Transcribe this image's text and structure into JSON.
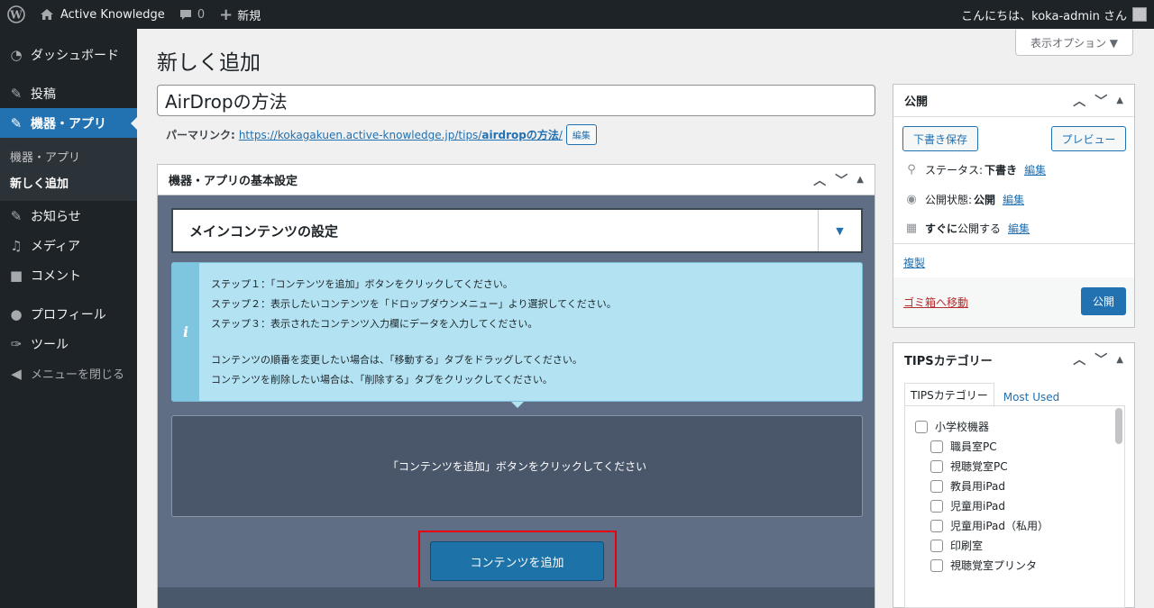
{
  "adminbar": {
    "site_name": "Active Knowledge",
    "comments_count": "0",
    "new_label": "新規",
    "greeting": "こんにちは、koka-admin さん"
  },
  "sidebar": {
    "items": [
      {
        "label": "ダッシュボード",
        "icon": "dashboard-icon"
      },
      {
        "label": "投稿",
        "icon": "pin-icon"
      },
      {
        "label": "機器・アプリ",
        "icon": "pin-icon"
      },
      {
        "label": "お知らせ",
        "icon": "pin-icon"
      },
      {
        "label": "メディア",
        "icon": "media-icon"
      },
      {
        "label": "コメント",
        "icon": "comment-icon"
      },
      {
        "label": "プロフィール",
        "icon": "user-icon"
      },
      {
        "label": "ツール",
        "icon": "wrench-icon"
      }
    ],
    "submenu": [
      "機器・アプリ",
      "新しく追加"
    ],
    "collapse_label": "メニューを閉じる"
  },
  "screen_options_label": "表示オプション ▼",
  "page_title": "新しく追加",
  "post_title": "AirDropの方法",
  "permalink": {
    "label": "パーマリンク:",
    "url_base": "https://kokagakuen.active-knowledge.jp/tips/",
    "slug": "airdropの方法",
    "url_trailing": "/",
    "edit_label": "編集"
  },
  "main_box": {
    "title": "機器・アプリの基本設定",
    "content_header": "メインコンテンツの設定",
    "info_lines": [
      "ステップ１：「コンテンツを追加」ボタンをクリックしてください。",
      "ステップ２：表示したいコンテンツを「ドロップダウンメニュー」より選択してください。",
      "ステップ３：表示されたコンテンツ入力欄にデータを入力してください。",
      "コンテンツの順番を変更したい場合は、「移動する」タブをドラッグしてください。",
      "コンテンツを削除したい場合は、「削除する」タブをクリックしてください。"
    ],
    "info_icon": "i",
    "empty_message": "「コンテンツを追加」ボタンをクリックしてください",
    "add_button": "コンテンツを追加"
  },
  "publish": {
    "title": "公開",
    "save_draft": "下書き保存",
    "preview": "プレビュー",
    "status_label": "ステータス:",
    "status_value": "下書き",
    "visibility_label": "公開状態:",
    "visibility_value": "公開",
    "schedule_bold": "すぐに",
    "schedule_rest": "公開する",
    "edit_label": "編集",
    "duplicate": "複製",
    "trash": "ゴミ箱へ移動",
    "publish_button": "公開"
  },
  "tips": {
    "title": "TIPSカテゴリー",
    "tab_all": "TIPSカテゴリー",
    "tab_most_used": "Most Used",
    "categories": [
      "小学校機器",
      "職員室PC",
      "視聴覚室PC",
      "教員用iPad",
      "児童用iPad",
      "児童用iPad（私用）",
      "印刷室",
      "視聴覚室プリンタ"
    ]
  },
  "colors": {
    "admin_bg": "#1d2327",
    "accent": "#2271b1",
    "info_bg": "#b3e3f3",
    "highlight": "#e60012"
  }
}
